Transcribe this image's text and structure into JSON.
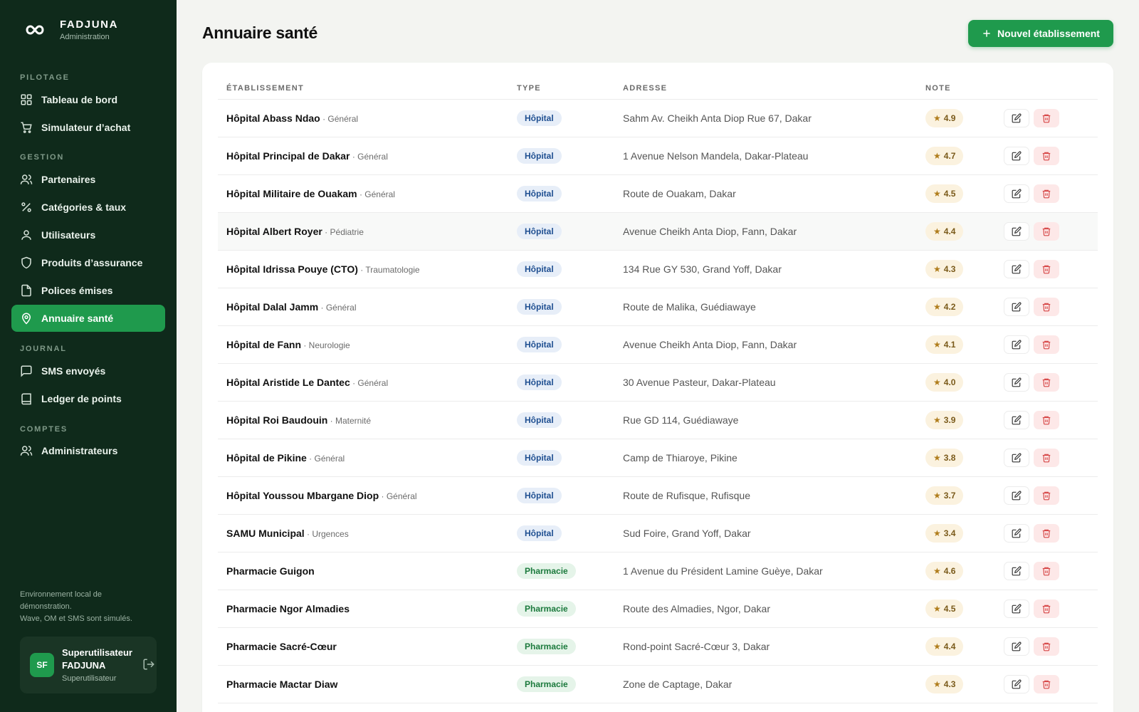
{
  "brand": {
    "name": "FADJUNA",
    "subtitle": "Administration"
  },
  "sidebar": {
    "sections": [
      {
        "label": "PILOTAGE",
        "items": [
          {
            "label": "Tableau de bord",
            "icon": "grid-icon"
          },
          {
            "label": "Simulateur d’achat",
            "icon": "cart-icon"
          }
        ]
      },
      {
        "label": "GESTION",
        "items": [
          {
            "label": "Partenaires",
            "icon": "users-icon"
          },
          {
            "label": "Catégories & taux",
            "icon": "percent-icon"
          },
          {
            "label": "Utilisateurs",
            "icon": "user-icon"
          },
          {
            "label": "Produits d’assurance",
            "icon": "shield-icon"
          },
          {
            "label": "Polices émises",
            "icon": "document-icon"
          },
          {
            "label": "Annuaire santé",
            "icon": "map-pin-icon",
            "active": true
          }
        ]
      },
      {
        "label": "JOURNAL",
        "items": [
          {
            "label": "SMS envoyés",
            "icon": "message-icon"
          },
          {
            "label": "Ledger de points",
            "icon": "book-icon"
          }
        ]
      },
      {
        "label": "COMPTES",
        "items": [
          {
            "label": "Administrateurs",
            "icon": "users-icon"
          }
        ]
      }
    ],
    "env_note_line1": "Environnement local de démonstration.",
    "env_note_line2": "Wave, OM et SMS sont simulés.",
    "user": {
      "initials": "SF",
      "name": "Superutilisateur FADJUNA",
      "role": "Superutilisateur"
    }
  },
  "page": {
    "title": "Annuaire santé",
    "new_button_label": "Nouvel établissement"
  },
  "table": {
    "columns": {
      "name": "ÉTABLISSEMENT",
      "type": "TYPE",
      "address": "ADRESSE",
      "rating": "NOTE"
    },
    "rows": [
      {
        "name": "Hôpital Abass Ndao",
        "spec": "Général",
        "type": "Hôpital",
        "address": "Sahm Av. Cheikh Anta Diop Rue 67, Dakar",
        "rating": "4.9"
      },
      {
        "name": "Hôpital Principal de Dakar",
        "spec": "Général",
        "type": "Hôpital",
        "address": "1 Avenue Nelson Mandela, Dakar-Plateau",
        "rating": "4.7"
      },
      {
        "name": "Hôpital Militaire de Ouakam",
        "spec": "Général",
        "type": "Hôpital",
        "address": "Route de Ouakam, Dakar",
        "rating": "4.5"
      },
      {
        "name": "Hôpital Albert Royer",
        "spec": "Pédiatrie",
        "type": "Hôpital",
        "address": "Avenue Cheikh Anta Diop, Fann, Dakar",
        "rating": "4.4"
      },
      {
        "name": "Hôpital Idrissa Pouye (CTO)",
        "spec": "Traumatologie",
        "type": "Hôpital",
        "address": "134 Rue GY 530, Grand Yoff, Dakar",
        "rating": "4.3"
      },
      {
        "name": "Hôpital Dalal Jamm",
        "spec": "Général",
        "type": "Hôpital",
        "address": "Route de Malika, Guédiawaye",
        "rating": "4.2"
      },
      {
        "name": "Hôpital de Fann",
        "spec": "Neurologie",
        "type": "Hôpital",
        "address": "Avenue Cheikh Anta Diop, Fann, Dakar",
        "rating": "4.1"
      },
      {
        "name": "Hôpital Aristide Le Dantec",
        "spec": "Général",
        "type": "Hôpital",
        "address": "30 Avenue Pasteur, Dakar-Plateau",
        "rating": "4.0"
      },
      {
        "name": "Hôpital Roi Baudouin",
        "spec": "Maternité",
        "type": "Hôpital",
        "address": "Rue GD 114, Guédiawaye",
        "rating": "3.9"
      },
      {
        "name": "Hôpital de Pikine",
        "spec": "Général",
        "type": "Hôpital",
        "address": "Camp de Thiaroye, Pikine",
        "rating": "3.8"
      },
      {
        "name": "Hôpital Youssou Mbargane Diop",
        "spec": "Général",
        "type": "Hôpital",
        "address": "Route de Rufisque, Rufisque",
        "rating": "3.7"
      },
      {
        "name": "SAMU Municipal",
        "spec": "Urgences",
        "type": "Hôpital",
        "address": "Sud Foire, Grand Yoff, Dakar",
        "rating": "3.4"
      },
      {
        "name": "Pharmacie Guigon",
        "spec": "",
        "type": "Pharmacie",
        "address": "1 Avenue du Président Lamine Guèye, Dakar",
        "rating": "4.6"
      },
      {
        "name": "Pharmacie Ngor Almadies",
        "spec": "",
        "type": "Pharmacie",
        "address": "Route des Almadies, Ngor, Dakar",
        "rating": "4.5"
      },
      {
        "name": "Pharmacie Sacré-Cœur",
        "spec": "",
        "type": "Pharmacie",
        "address": "Rond-point Sacré-Cœur 3, Dakar",
        "rating": "4.4"
      },
      {
        "name": "Pharmacie Mactar Diaw",
        "spec": "",
        "type": "Pharmacie",
        "address": "Zone de Captage, Dakar",
        "rating": "4.3"
      }
    ]
  },
  "colors": {
    "sidebar_bg": "#0f2a1b",
    "accent": "#1f9a4d",
    "page_bg": "#f3f4f1"
  }
}
